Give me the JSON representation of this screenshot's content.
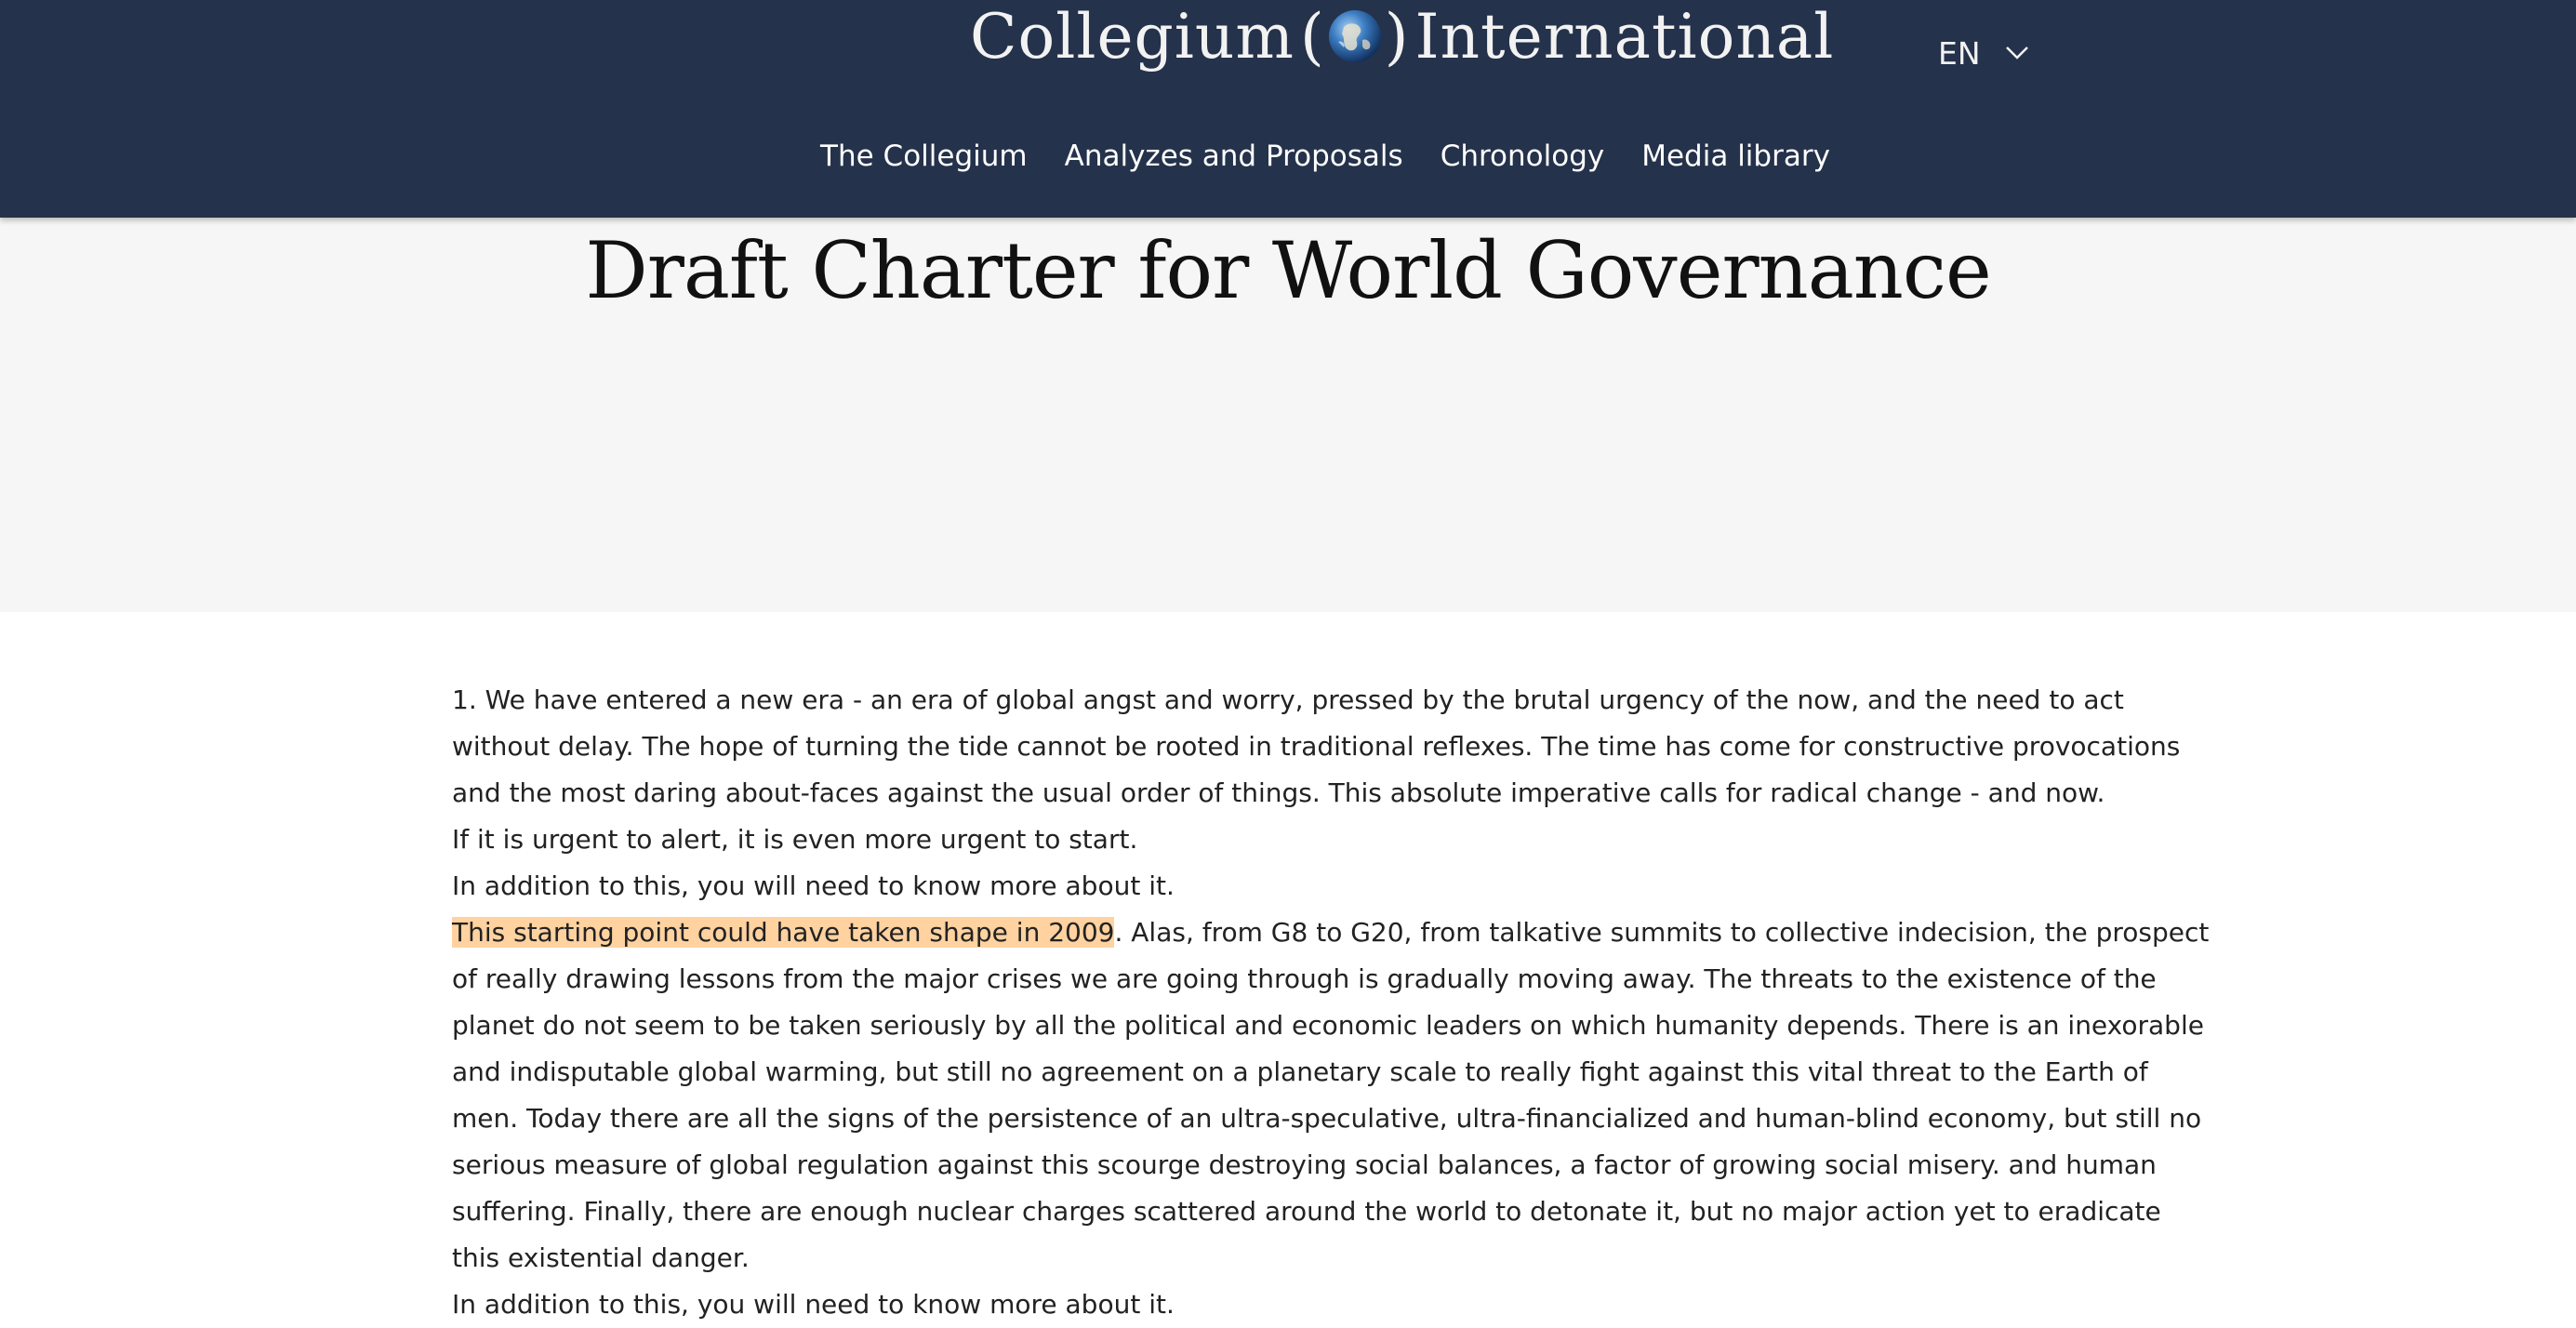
{
  "header": {
    "logo_left": "Collegium",
    "logo_paren_open": "(",
    "logo_paren_close": ")",
    "logo_right": "International",
    "logo_icon": "globe-icon",
    "language": "EN",
    "language_icon": "chevron-down-icon",
    "background": "#25324b"
  },
  "nav": {
    "items": [
      {
        "label": "The Collegium"
      },
      {
        "label": "Analyzes and Proposals"
      },
      {
        "label": "Chronology"
      },
      {
        "label": "Media library"
      }
    ]
  },
  "hero": {
    "title": "Draft Charter for World Governance"
  },
  "content": {
    "p1": "1. We have entered a new era - an era of global angst and worry, pressed by the brutal urgency of the now, and the need to act without delay. The hope of turning the tide cannot be rooted in traditional reflexes. The time has come for constructive provocations and the most daring about-faces against the usual order of things. This absolute imperative calls for radical change - and now.",
    "p2": "If it is urgent to alert, it is even more urgent to start.",
    "p3": "In addition to this, you will need to know more about it.",
    "p4_highlight": "This starting point could have taken shape in 2009",
    "p4_rest": ". Alas, from G8 to G20, from talkative summits to collective indecision, the prospect of really drawing lessons from the major crises we are going through is gradually moving away. The threats to the existence of the planet do not seem to be taken seriously by all the political and economic leaders on which humanity depends. There is an inexorable and indisputable global warming, but still no agreement on a planetary scale to really fight against this vital threat to the Earth of men. Today there are all the signs of the persistence of an ultra-speculative, ultra-financialized and human-blind economy, but still no serious measure of global regulation against this scourge destroying social balances, a factor of growing social misery. and human suffering. Finally, there are enough nuclear charges scattered around the world to detonate it, but no major action yet to eradicate this existential danger.",
    "p5": "In addition to this, you will need to know more about it.",
    "highlight_color": "#ffd2a0"
  }
}
